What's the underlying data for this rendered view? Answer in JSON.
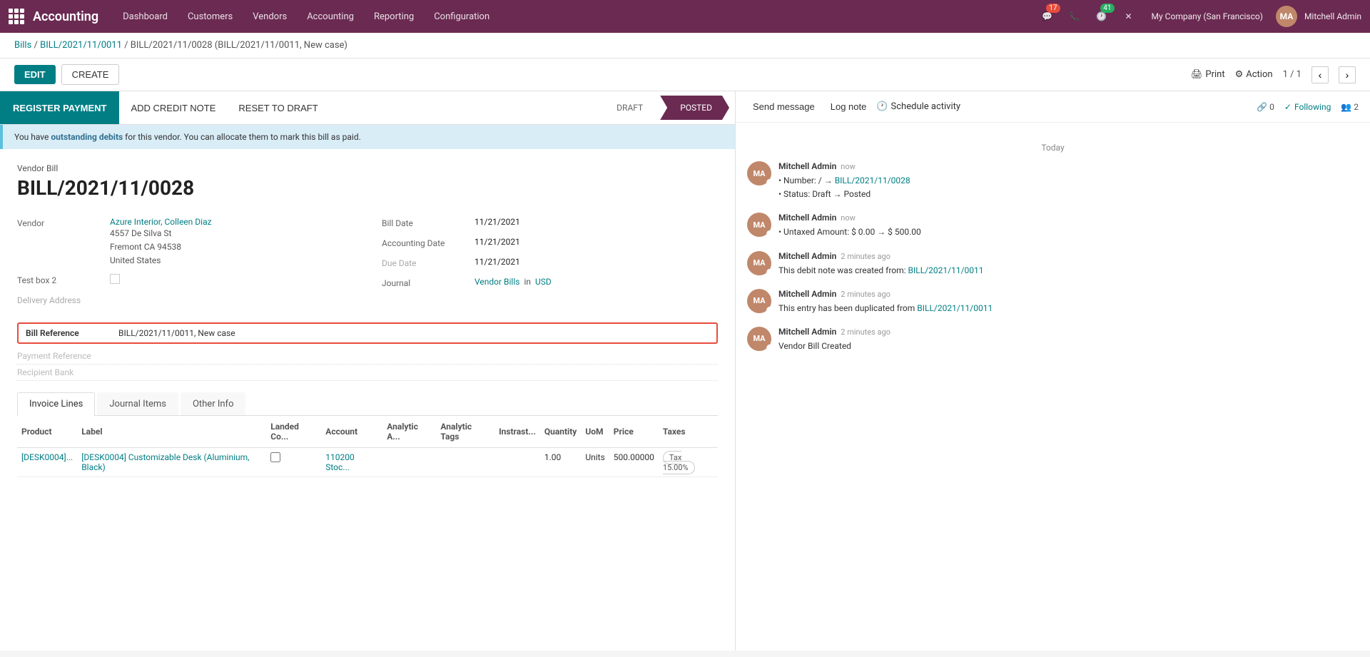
{
  "topnav": {
    "brand": "Accounting",
    "menu_items": [
      "Dashboard",
      "Customers",
      "Vendors",
      "Accounting",
      "Reporting",
      "Configuration"
    ],
    "notifications_count": "17",
    "phone_icon": "📞",
    "activity_count": "41",
    "close_icon": "✕",
    "company": "My Company (San Francisco)",
    "user": "Mitchell Admin"
  },
  "breadcrumb": {
    "parts": [
      "Bills",
      "BILL/2021/11/0011",
      "BILL/2021/11/0028 (BILL/2021/11/0011, New case)"
    ]
  },
  "action_bar": {
    "edit_label": "EDIT",
    "create_label": "CREATE",
    "print_label": "Print",
    "action_label": "Action",
    "pagination": "1 / 1"
  },
  "status_bar": {
    "register_payment_label": "REGISTER PAYMENT",
    "add_credit_note_label": "ADD CREDIT NOTE",
    "reset_to_draft_label": "RESET TO DRAFT",
    "draft_label": "DRAFT",
    "posted_label": "POSTED"
  },
  "outstanding_notice": {
    "text_pre": "You have ",
    "text_bold": "outstanding debits",
    "text_post": " for this vendor. You can allocate them to mark this bill as paid."
  },
  "form": {
    "doc_type": "Vendor Bill",
    "doc_number": "BILL/2021/11/0028",
    "vendor_label": "Vendor",
    "vendor_name": "Azure Interior, Colleen Diaz",
    "vendor_address_1": "4557 De Silva St",
    "vendor_address_2": "Fremont CA 94538",
    "vendor_address_3": "United States",
    "test_box_2_label": "Test box 2",
    "delivery_address_label": "Delivery Address",
    "bill_reference_label": "Bill Reference",
    "bill_reference_value": "BILL/2021/11/0011, New case",
    "payment_reference_label": "Payment Reference",
    "recipient_bank_label": "Recipient Bank",
    "bill_date_label": "Bill Date",
    "bill_date_value": "11/21/2021",
    "accounting_date_label": "Accounting Date",
    "accounting_date_value": "11/21/2021",
    "due_date_label": "Due Date",
    "due_date_value": "11/21/2021",
    "journal_label": "Journal",
    "journal_value": "Vendor Bills",
    "journal_currency": "USD"
  },
  "tabs": [
    {
      "label": "Invoice Lines",
      "active": true
    },
    {
      "label": "Journal Items",
      "active": false
    },
    {
      "label": "Other Info",
      "active": false
    }
  ],
  "table": {
    "headers": [
      "Product",
      "Label",
      "Landed Co...",
      "Account",
      "Analytic A...",
      "Analytic Tags",
      "Instrast...",
      "Quantity",
      "UoM",
      "Price",
      "Taxes"
    ],
    "rows": [
      {
        "product": "[DESK0004]...",
        "label": "[DESK0004] Customizable Desk (Aluminium, Black)",
        "landed_cost": "",
        "account": "110200 Stoc...",
        "analytic_a": "",
        "analytic_tags": "",
        "instrastructure": "",
        "quantity": "1.00",
        "uom": "Units",
        "price": "500.00000",
        "taxes": "Tax 15.00%"
      }
    ]
  },
  "chatter": {
    "send_message_label": "Send message",
    "log_note_label": "Log note",
    "schedule_activity_label": "Schedule activity",
    "followers_count": "0",
    "following_label": "Following",
    "members_count": "2",
    "date_separator": "Today",
    "messages": [
      {
        "author": "Mitchell Admin",
        "time": "now",
        "lines": [
          {
            "type": "bullet",
            "text": "Number: / → BILL/2021/11/0028"
          },
          {
            "type": "bullet",
            "text": "Status: Draft → Posted"
          }
        ]
      },
      {
        "author": "Mitchell Admin",
        "time": "now",
        "lines": [
          {
            "type": "bullet",
            "text": "Untaxed Amount: $ 0.00 → $ 500.00"
          }
        ]
      },
      {
        "author": "Mitchell Admin",
        "time": "2 minutes ago",
        "lines": [
          {
            "type": "text",
            "text": "This debit note was created from: BILL/2021/11/0011"
          }
        ]
      },
      {
        "author": "Mitchell Admin",
        "time": "2 minutes ago",
        "lines": [
          {
            "type": "text",
            "text": "This entry has been duplicated from BILL/2021/11/0011"
          }
        ]
      },
      {
        "author": "Mitchell Admin",
        "time": "2 minutes ago",
        "lines": [
          {
            "type": "text",
            "text": "Vendor Bill Created"
          }
        ]
      }
    ]
  }
}
